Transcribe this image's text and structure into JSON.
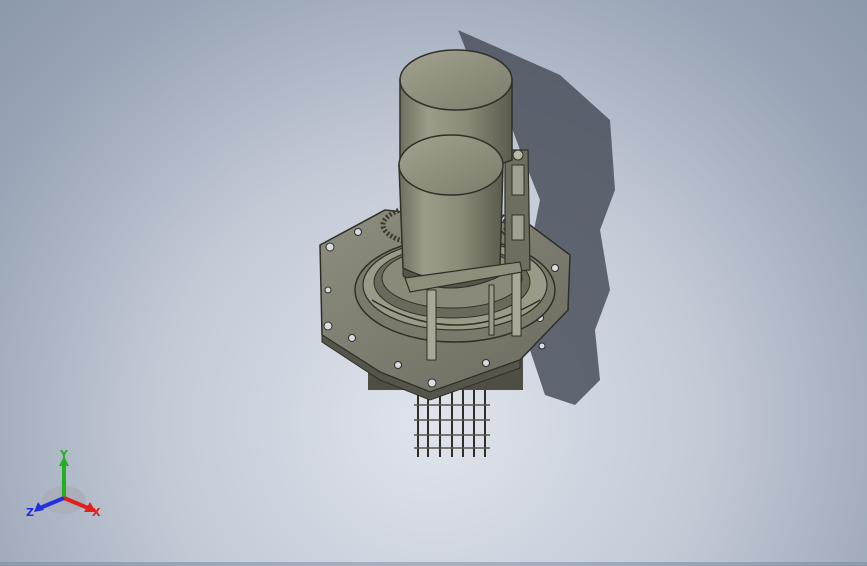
{
  "viewport": {
    "background_top": "#8c98ab",
    "background_bottom": "#dfe4ec",
    "model_name": "3d-assembly-model",
    "model_color": "#898979"
  },
  "triad": {
    "x_label": "X",
    "y_label": "Y",
    "z_label": "Z",
    "x_color": "#e0201a",
    "y_color": "#20b020",
    "z_color": "#2030e0"
  }
}
